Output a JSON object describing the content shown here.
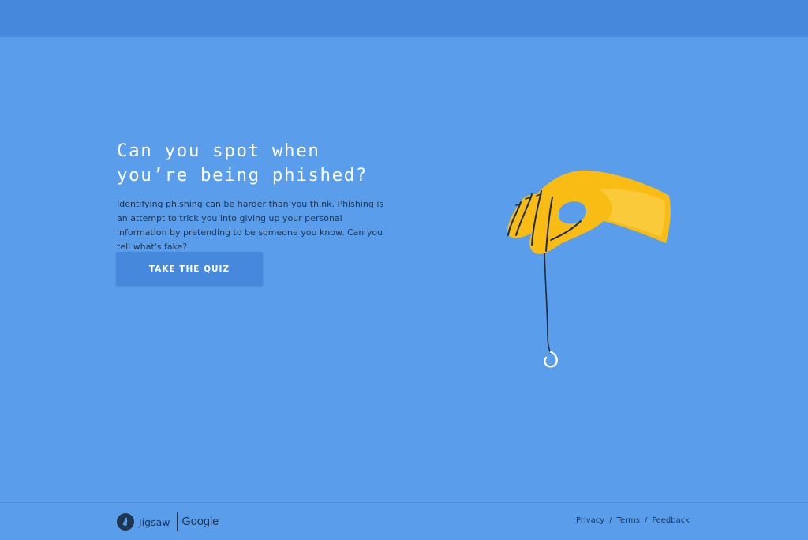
{
  "colors": {
    "background": "#5a9deb",
    "header_bar": "#4689dc",
    "button": "#4689dc",
    "text_dark": "#1f3550",
    "hand": "#f9bc15"
  },
  "hero": {
    "title_line_1": "Can you spot when",
    "title_line_2": "you’re being phished?",
    "description": "Identifying phishing can be harder than you think. Phishing is an attempt to trick you into giving up your personal information by pretending to be someone you know. Can you tell what's fake?",
    "cta_label": "TAKE THE QUIZ"
  },
  "illustration": {
    "icon": "hand-holding-fishing-hook"
  },
  "footer": {
    "brand_jigsaw": "Jigsaw",
    "brand_google": "Google",
    "links": {
      "privacy": "Privacy",
      "terms": "Terms",
      "feedback": "Feedback"
    },
    "separator": "/"
  }
}
